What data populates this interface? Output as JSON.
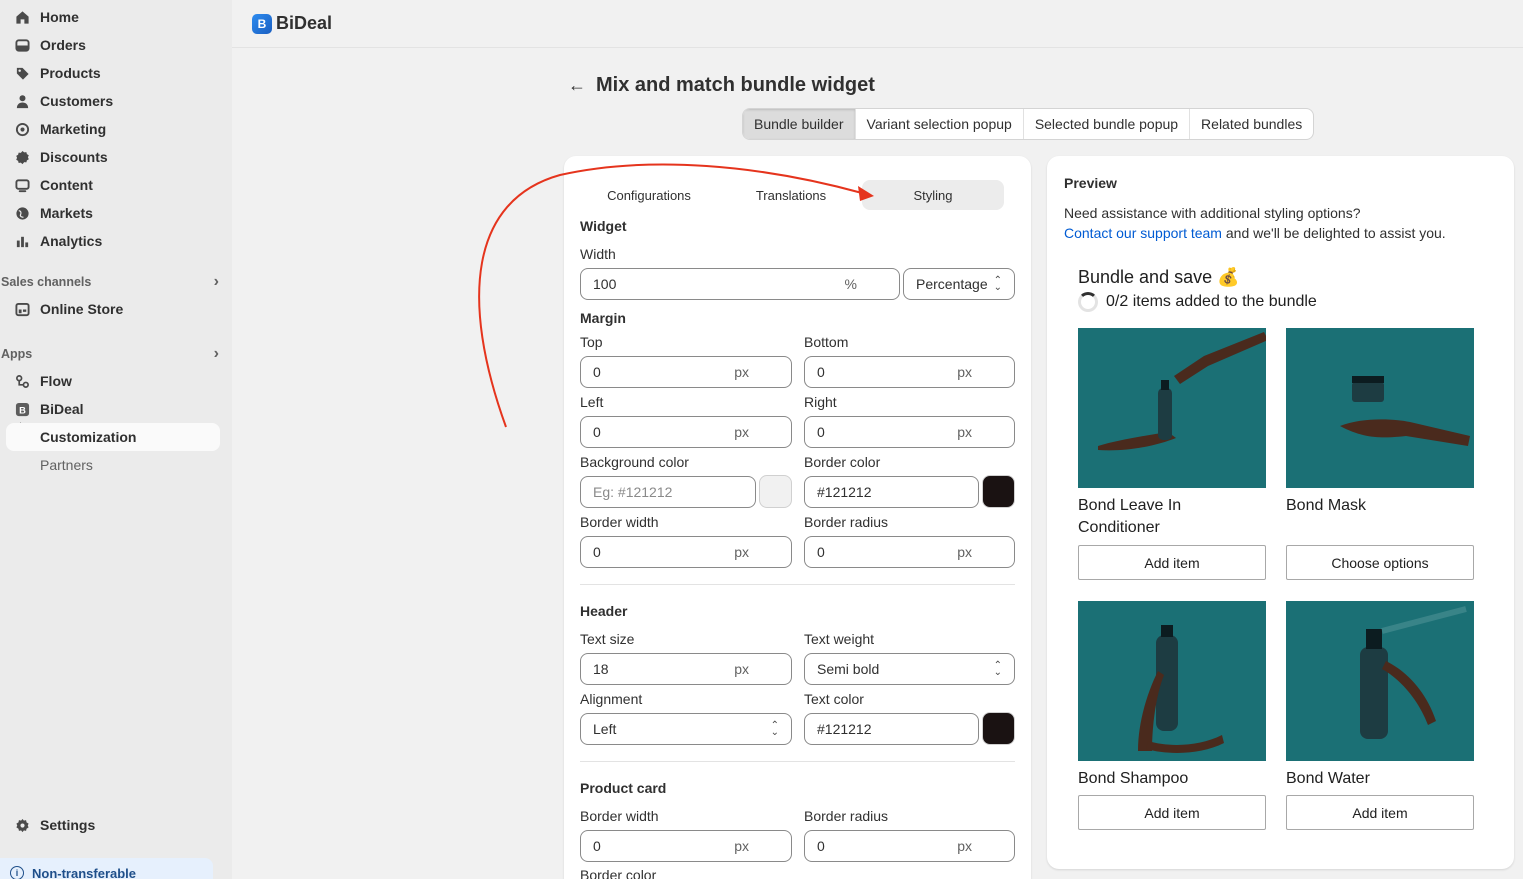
{
  "sidebar": {
    "items": [
      {
        "label": "Home",
        "icon": "home-icon"
      },
      {
        "label": "Orders",
        "icon": "orders-icon"
      },
      {
        "label": "Products",
        "icon": "tag-icon"
      },
      {
        "label": "Customers",
        "icon": "person-icon"
      },
      {
        "label": "Marketing",
        "icon": "target-icon"
      },
      {
        "label": "Discounts",
        "icon": "discount-icon"
      },
      {
        "label": "Content",
        "icon": "content-icon"
      },
      {
        "label": "Markets",
        "icon": "globe-icon"
      },
      {
        "label": "Analytics",
        "icon": "bar-chart-icon"
      }
    ],
    "sales_channels_label": "Sales channels",
    "online_store": "Online Store",
    "apps_label": "Apps",
    "flow": "Flow",
    "bideal": "BiDeal",
    "customization": "Customization",
    "partners": "Partners",
    "settings": "Settings",
    "non_transferable": "Non-transferable"
  },
  "appbar": {
    "name": "BiDeal",
    "logo_letter": "B"
  },
  "page": {
    "title": "Mix and match bundle widget",
    "tabs": [
      "Bundle builder",
      "Variant selection popup",
      "Selected bundle popup",
      "Related bundles"
    ]
  },
  "settings_card": {
    "subtabs": [
      "Configurations",
      "Translations",
      "Styling"
    ],
    "widget": {
      "title": "Widget",
      "width_label": "Width",
      "width_value": "100",
      "width_unit": "%",
      "width_type": "Percentage",
      "margin_title": "Margin",
      "top_label": "Top",
      "top_value": "0",
      "bottom_label": "Bottom",
      "bottom_value": "0",
      "left_label": "Left",
      "left_value": "0",
      "right_label": "Right",
      "right_value": "0",
      "px": "px",
      "bg_color_label": "Background color",
      "bg_color_placeholder": "Eg: #121212",
      "border_color_label": "Border color",
      "border_color_value": "#121212",
      "border_width_label": "Border width",
      "border_width_value": "0",
      "border_radius_label": "Border radius",
      "border_radius_value": "0"
    },
    "header": {
      "title": "Header",
      "text_size_label": "Text size",
      "text_size_value": "18",
      "text_weight_label": "Text weight",
      "text_weight_value": "Semi bold",
      "alignment_label": "Alignment",
      "alignment_value": "Left",
      "text_color_label": "Text color",
      "text_color_value": "#121212"
    },
    "product_card": {
      "title": "Product card",
      "border_width_label": "Border width",
      "border_width_value": "0",
      "border_radius_label": "Border radius",
      "border_radius_value": "0",
      "border_color_label": "Border color"
    }
  },
  "preview": {
    "title": "Preview",
    "desc_line1": "Need assistance with additional styling options?",
    "desc_link": "Contact our support team",
    "desc_rest": " and we'll be delighted to assist you.",
    "bundle_title": "Bundle and save 💰",
    "progress_text": "0/2 items added to the bundle",
    "products": [
      {
        "name": "Bond Leave In Conditioner",
        "button": "Add item"
      },
      {
        "name": "Bond Mask",
        "button": "Choose options"
      },
      {
        "name": "Bond Shampoo",
        "button": "Add item"
      },
      {
        "name": "Bond Water",
        "button": "Add item"
      }
    ]
  },
  "colors": {
    "accent_link": "#005bd3",
    "product_bg": "#1b7075",
    "swatch_dark": "#1a1212",
    "swatch_light": "#f1f1f1",
    "annotation": "#e5341d"
  }
}
